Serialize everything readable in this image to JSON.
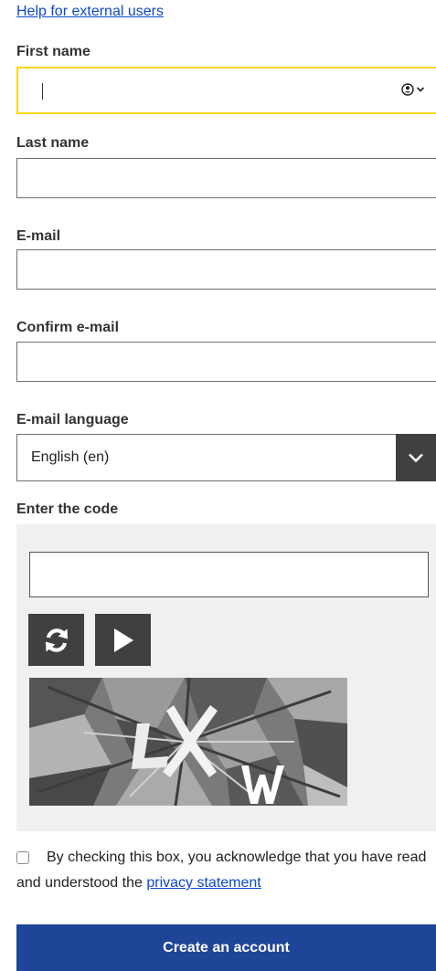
{
  "help_link": "Help for external users",
  "fields": {
    "first_name": {
      "label": "First name",
      "value": ""
    },
    "last_name": {
      "label": "Last name",
      "value": ""
    },
    "email": {
      "label": "E-mail",
      "value": ""
    },
    "confirm_email": {
      "label": "Confirm e-mail",
      "value": ""
    }
  },
  "email_language": {
    "label": "E-mail language",
    "selected": "English (en)"
  },
  "captcha": {
    "label": "Enter the code",
    "value": ""
  },
  "consent": {
    "text": "By checking this box, you acknowledge that you have read and understood the ",
    "link": "privacy statement",
    "checked": false
  },
  "submit_label": "Create an account",
  "colors": {
    "link": "#0e47cb",
    "focus": "#ffd617",
    "primary": "#1f4598",
    "dark_button": "#404040"
  },
  "icons": {
    "autofill": "contact-card-icon",
    "select": "chevron-down-icon",
    "refresh": "refresh-icon",
    "audio": "play-icon"
  }
}
